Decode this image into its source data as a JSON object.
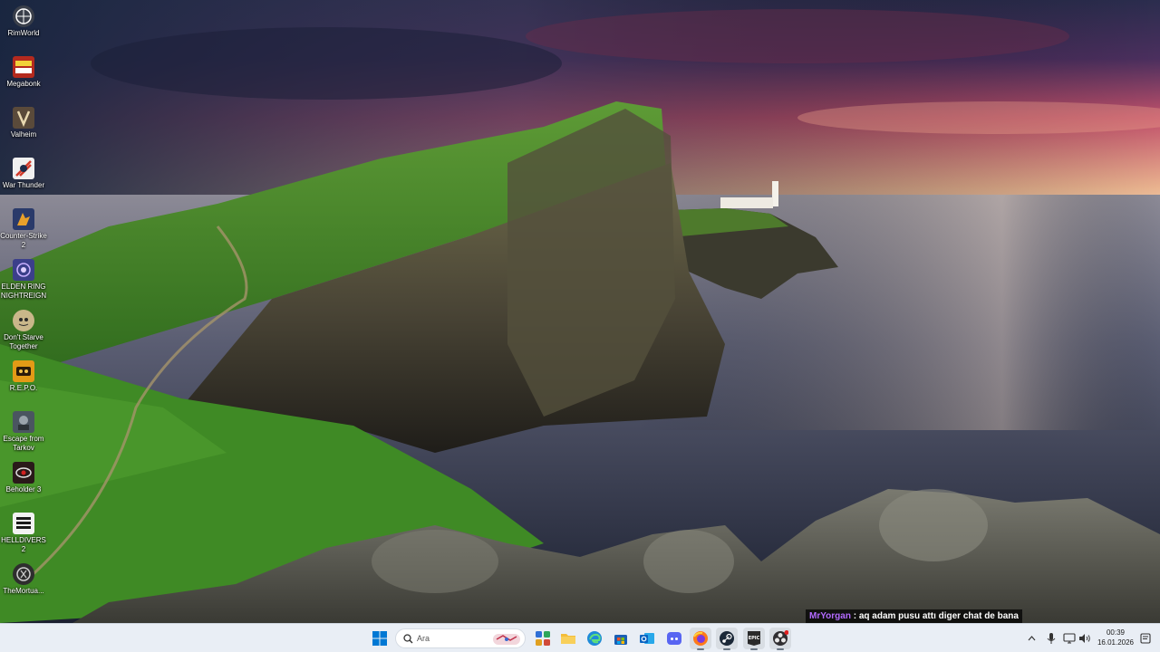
{
  "desktop_icons": [
    {
      "label": "RimWorld",
      "icon": "rimworld-icon",
      "color": "#3a3f4a"
    },
    {
      "label": "Megabonk",
      "icon": "megabonk-icon",
      "color": "#b42a1e"
    },
    {
      "label": "Valheim",
      "icon": "valheim-icon",
      "color": "#5a4a3a"
    },
    {
      "label": "War Thunder",
      "icon": "war-thunder-icon",
      "color": "#d23a2a"
    },
    {
      "label": "Counter-Strike 2",
      "icon": "counter-strike-icon",
      "color": "#e8a02a"
    },
    {
      "label": "ELDEN RING NIGHTREIGN",
      "icon": "elden-ring-icon",
      "color": "#3b3f8a"
    },
    {
      "label": "Don't Starve Together",
      "icon": "dont-starve-icon",
      "color": "#c9b78a"
    },
    {
      "label": "R.E.P.O.",
      "icon": "repo-icon",
      "color": "#e39a16"
    },
    {
      "label": "Escape from Tarkov",
      "icon": "tarkov-icon",
      "color": "#4a5560"
    },
    {
      "label": "Beholder 3",
      "icon": "beholder-icon",
      "color": "#2a1a1a"
    },
    {
      "label": "HELLDIVERS 2",
      "icon": "helldivers-icon",
      "color": "#1a1a1a"
    },
    {
      "label": "TheMortua...",
      "icon": "mortuary-icon",
      "color": "#2e2e2e"
    }
  ],
  "chat": {
    "user": "MrYorgan",
    "separator": " : ",
    "message": "aq adam pusu attı diger chat de bana"
  },
  "taskbar": {
    "search_placeholder": "Ara",
    "pinned": [
      {
        "name": "widgets",
        "icon": "widgets-icon"
      },
      {
        "name": "file-explorer",
        "icon": "folder-icon"
      },
      {
        "name": "edge",
        "icon": "edge-icon"
      },
      {
        "name": "store",
        "icon": "store-icon"
      },
      {
        "name": "outlook",
        "icon": "outlook-icon"
      },
      {
        "name": "discord",
        "icon": "discord-icon"
      },
      {
        "name": "firefox",
        "icon": "firefox-icon"
      },
      {
        "name": "steam",
        "icon": "steam-icon"
      },
      {
        "name": "epic-games",
        "icon": "epic-games-icon"
      },
      {
        "name": "obs",
        "icon": "obs-icon"
      }
    ],
    "epic_label": "EPIC",
    "clock_time": "00:39",
    "clock_date": "16.01.2026"
  },
  "colors": {
    "taskbar_bg": "#e9eef5",
    "chat_user": "#b36bff",
    "windows_blue": "#0078d4"
  }
}
